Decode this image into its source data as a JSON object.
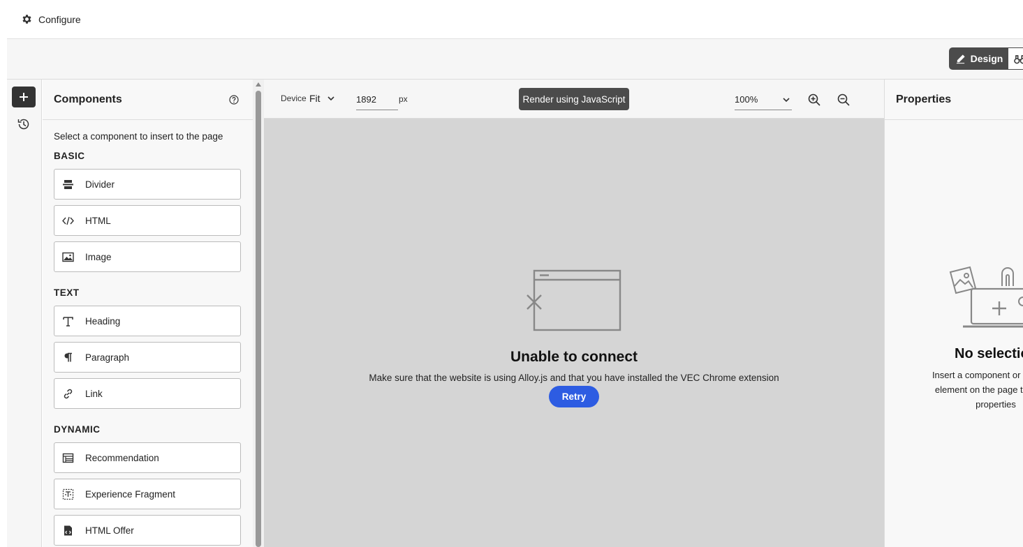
{
  "topbar": {
    "configure_label": "Configure"
  },
  "modebar": {
    "design_label": "Design"
  },
  "components": {
    "title": "Components",
    "hint": "Select a component to insert to the page",
    "sections": [
      {
        "label": "BASIC",
        "items": [
          {
            "label": "Divider",
            "icon": "divider-icon"
          },
          {
            "label": "HTML",
            "icon": "code-icon"
          },
          {
            "label": "Image",
            "icon": "image-icon"
          }
        ]
      },
      {
        "label": "TEXT",
        "items": [
          {
            "label": "Heading",
            "icon": "heading-icon"
          },
          {
            "label": "Paragraph",
            "icon": "paragraph-icon"
          },
          {
            "label": "Link",
            "icon": "link-icon"
          }
        ]
      },
      {
        "label": "DYNAMIC",
        "items": [
          {
            "label": "Recommendation",
            "icon": "recommendation-icon"
          },
          {
            "label": "Experience Fragment",
            "icon": "fragment-icon"
          },
          {
            "label": "HTML Offer",
            "icon": "html-offer-icon"
          }
        ]
      }
    ]
  },
  "canvas_toolbar": {
    "device_label": "Device",
    "device_value": "Fit",
    "width_value": "1892",
    "width_unit": "px",
    "render_label": "Render using JavaScript",
    "zoom_value": "100%"
  },
  "error": {
    "title": "Unable to connect",
    "description": "Make sure that the website is using Alloy.js and that you have installed the VEC Chrome extension",
    "retry_label": "Retry"
  },
  "properties": {
    "title": "Properties",
    "empty_title": "No selectio",
    "empty_desc": "Insert a component or select an element on the page to edit its properties"
  },
  "colors": {
    "accent": "#2d5ce2",
    "dark_button": "#4b4b4b",
    "canvas_bg": "#d5d5d5"
  }
}
